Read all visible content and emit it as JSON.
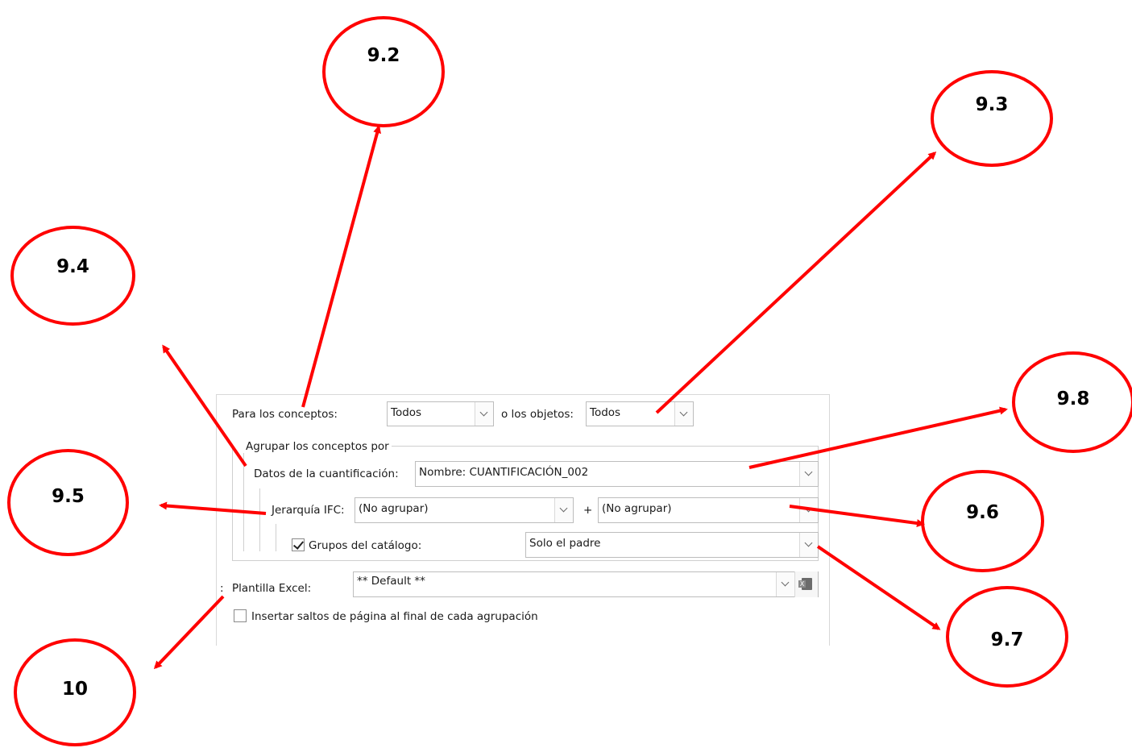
{
  "form": {
    "para_conceptos_label": "Para los conceptos:",
    "para_conceptos_value": "Todos",
    "objetos_label": "o los objetos:",
    "objetos_value": "Todos",
    "group_title": "Agrupar los conceptos por",
    "datos_label": "Datos de la cuantificación:",
    "datos_value": "Nombre: CUANTIFICACIÓN_002",
    "jerarquia_label": "Jerarquía IFC:",
    "jerarquia_value": "(No agrupar)",
    "plus_sign": "+",
    "jerarquia2_value": "(No agrupar)",
    "grupos_label": "Grupos del catálogo:",
    "grupos_checked": true,
    "grupos_value": "Solo el padre",
    "plantilla_prefix": ":",
    "plantilla_label": "Plantilla Excel:",
    "plantilla_value": "** Default **",
    "saltos_label": "Insertar saltos de página al final de cada agrupación",
    "saltos_checked": false
  },
  "callouts": {
    "c92": "9.2",
    "c93": "9.3",
    "c94": "9.4",
    "c95": "9.5",
    "c96": "9.6",
    "c97": "9.7",
    "c98": "9.8",
    "c10": "10"
  },
  "colors": {
    "annotation": "#ff0000"
  },
  "icons": {
    "excel": "excel-icon",
    "dropdown": "chevron-down-icon"
  }
}
